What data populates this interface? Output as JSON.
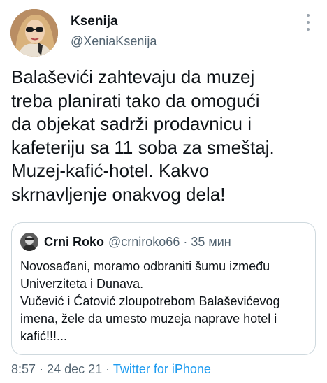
{
  "tweet": {
    "author": {
      "display_name": "Ksenija",
      "handle": "@XeniaKsenija"
    },
    "text": "Balaševići zahtevaju da muzej\ntreba planirati tako da omogući\nda objekat sadrži prodavnicu i\nkafeteriju sa 11 soba za smeštaj.\nMuzej-kafić-hotel. Kakvo\nskrnavljenje onakvog dela!",
    "more_icon": "more-vertical-icon",
    "quoted": {
      "display_name": "Crni Roko",
      "handle": "@crniroko66",
      "separator": "·",
      "time": "35 мин",
      "text": "Novosađani, moramo odbraniti šumu između\nUniverziteta i Dunava.\nVučević i Ćatović zloupotrebom Balaševićevog\nimena, žele da umesto muzeja naprave hotel i\nkafić!!!..."
    },
    "meta": {
      "time": "8:57",
      "separator": "·",
      "date": "24 dec 21",
      "source": "Twitter for iPhone"
    }
  },
  "colors": {
    "text": "#0f1419",
    "secondary": "#536471",
    "link": "#1d9bf0",
    "border": "#cfd9de"
  }
}
